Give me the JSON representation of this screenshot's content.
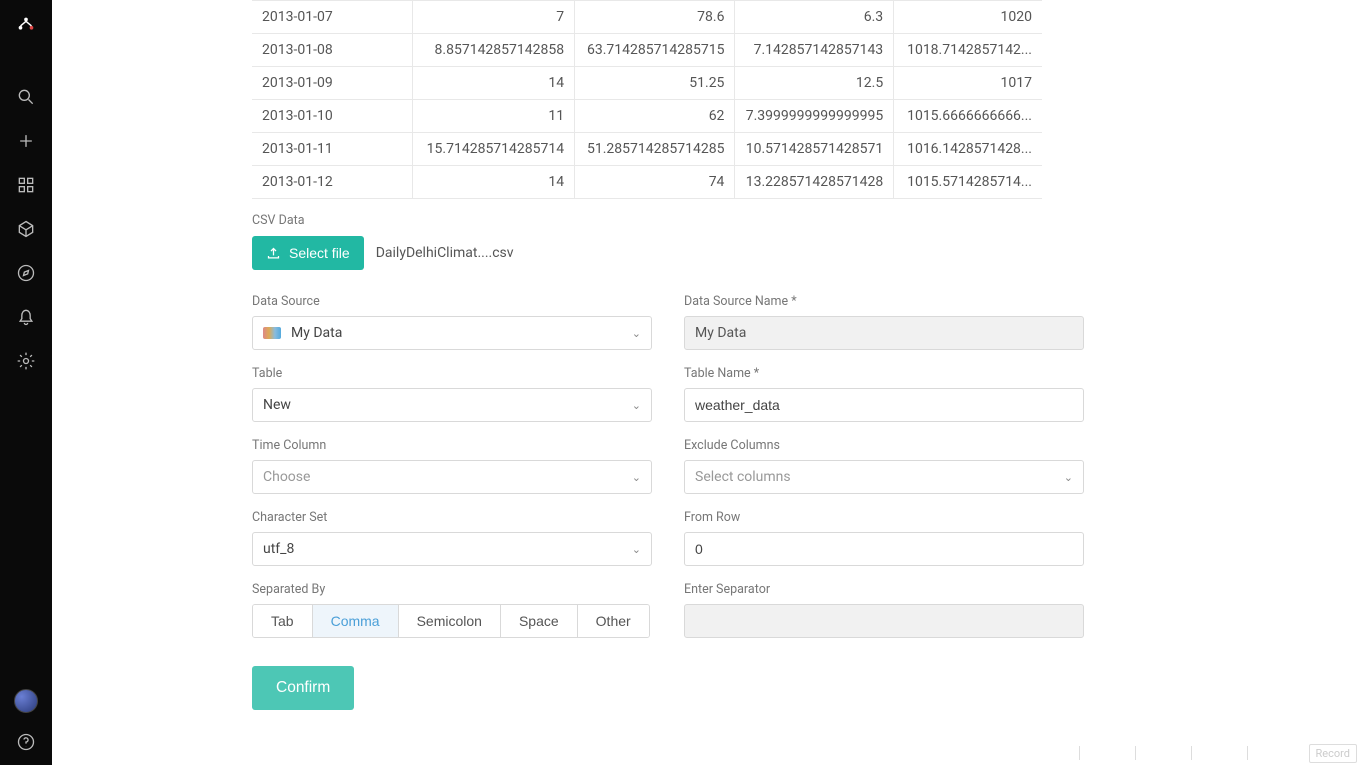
{
  "table_rows": [
    {
      "date": "2013-01-07",
      "c2": "7",
      "c3": "78.6",
      "c4": "6.3",
      "c5": "1020"
    },
    {
      "date": "2013-01-08",
      "c2": "8.857142857142858",
      "c3": "63.714285714285715",
      "c4": "7.142857142857143",
      "c5": "1018.7142857142..."
    },
    {
      "date": "2013-01-09",
      "c2": "14",
      "c3": "51.25",
      "c4": "12.5",
      "c5": "1017"
    },
    {
      "date": "2013-01-10",
      "c2": "11",
      "c3": "62",
      "c4": "7.3999999999999995",
      "c5": "1015.6666666666..."
    },
    {
      "date": "2013-01-11",
      "c2": "15.714285714285714",
      "c3": "51.285714285714285",
      "c4": "10.571428571428571",
      "c5": "1016.1428571428..."
    },
    {
      "date": "2013-01-12",
      "c2": "14",
      "c3": "74",
      "c4": "13.228571428571428",
      "c5": "1015.5714285714..."
    }
  ],
  "labels": {
    "csv_data": "CSV Data",
    "select_file": "Select file",
    "filename": "DailyDelhiClimat....csv",
    "data_source": "Data Source",
    "data_source_name": "Data Source Name *",
    "table": "Table",
    "table_name": "Table Name *",
    "time_column": "Time Column",
    "exclude_columns": "Exclude Columns",
    "character_set": "Character Set",
    "from_row": "From Row",
    "separated_by": "Separated By",
    "enter_separator": "Enter Separator",
    "confirm": "Confirm",
    "record": "Record"
  },
  "values": {
    "data_source": "My Data",
    "data_source_name": "My Data",
    "table": "New",
    "table_name": "weather_data",
    "time_column_placeholder": "Choose",
    "exclude_columns_placeholder": "Select columns",
    "character_set": "utf_8",
    "from_row": "0"
  },
  "separators": {
    "tab": "Tab",
    "comma": "Comma",
    "semicolon": "Semicolon",
    "space": "Space",
    "other": "Other"
  }
}
